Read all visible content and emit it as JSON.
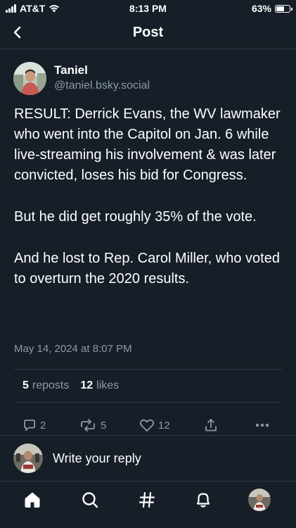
{
  "status_bar": {
    "carrier": "AT&T",
    "time": "8:13 PM",
    "battery_percent": "63%",
    "battery_level": 0.63
  },
  "header": {
    "title": "Post",
    "back_icon": "chevron-left-icon"
  },
  "post": {
    "author": {
      "name": "Taniel",
      "handle": "@taniel.bsky.social"
    },
    "paragraphs": [
      "RESULT: Derrick Evans, the WV lawmaker who went into the Capitol on Jan. 6 while live-streaming his involvement & was later convicted, loses his bid for Congress.",
      "But he did get roughly 35% of the vote.",
      "And he lost to Rep. Carol Miller, who voted to overturn the 2020 results."
    ],
    "timestamp": "May 14, 2024 at 8:07 PM",
    "stats": {
      "reposts_count": "5",
      "reposts_label": "reposts",
      "likes_count": "12",
      "likes_label": "likes"
    },
    "actions": {
      "reply_count": "2",
      "repost_count": "5",
      "like_count": "12"
    }
  },
  "reply": {
    "placeholder": "Write your reply"
  },
  "tab_bar": {
    "tabs": [
      "home-icon",
      "search-icon",
      "hashtag-icon",
      "notifications-icon",
      "profile-avatar"
    ]
  },
  "colors": {
    "background": "#161e27",
    "text_primary": "#ffffff",
    "text_secondary": "#8c9aab",
    "divider": "#2e3a47"
  }
}
